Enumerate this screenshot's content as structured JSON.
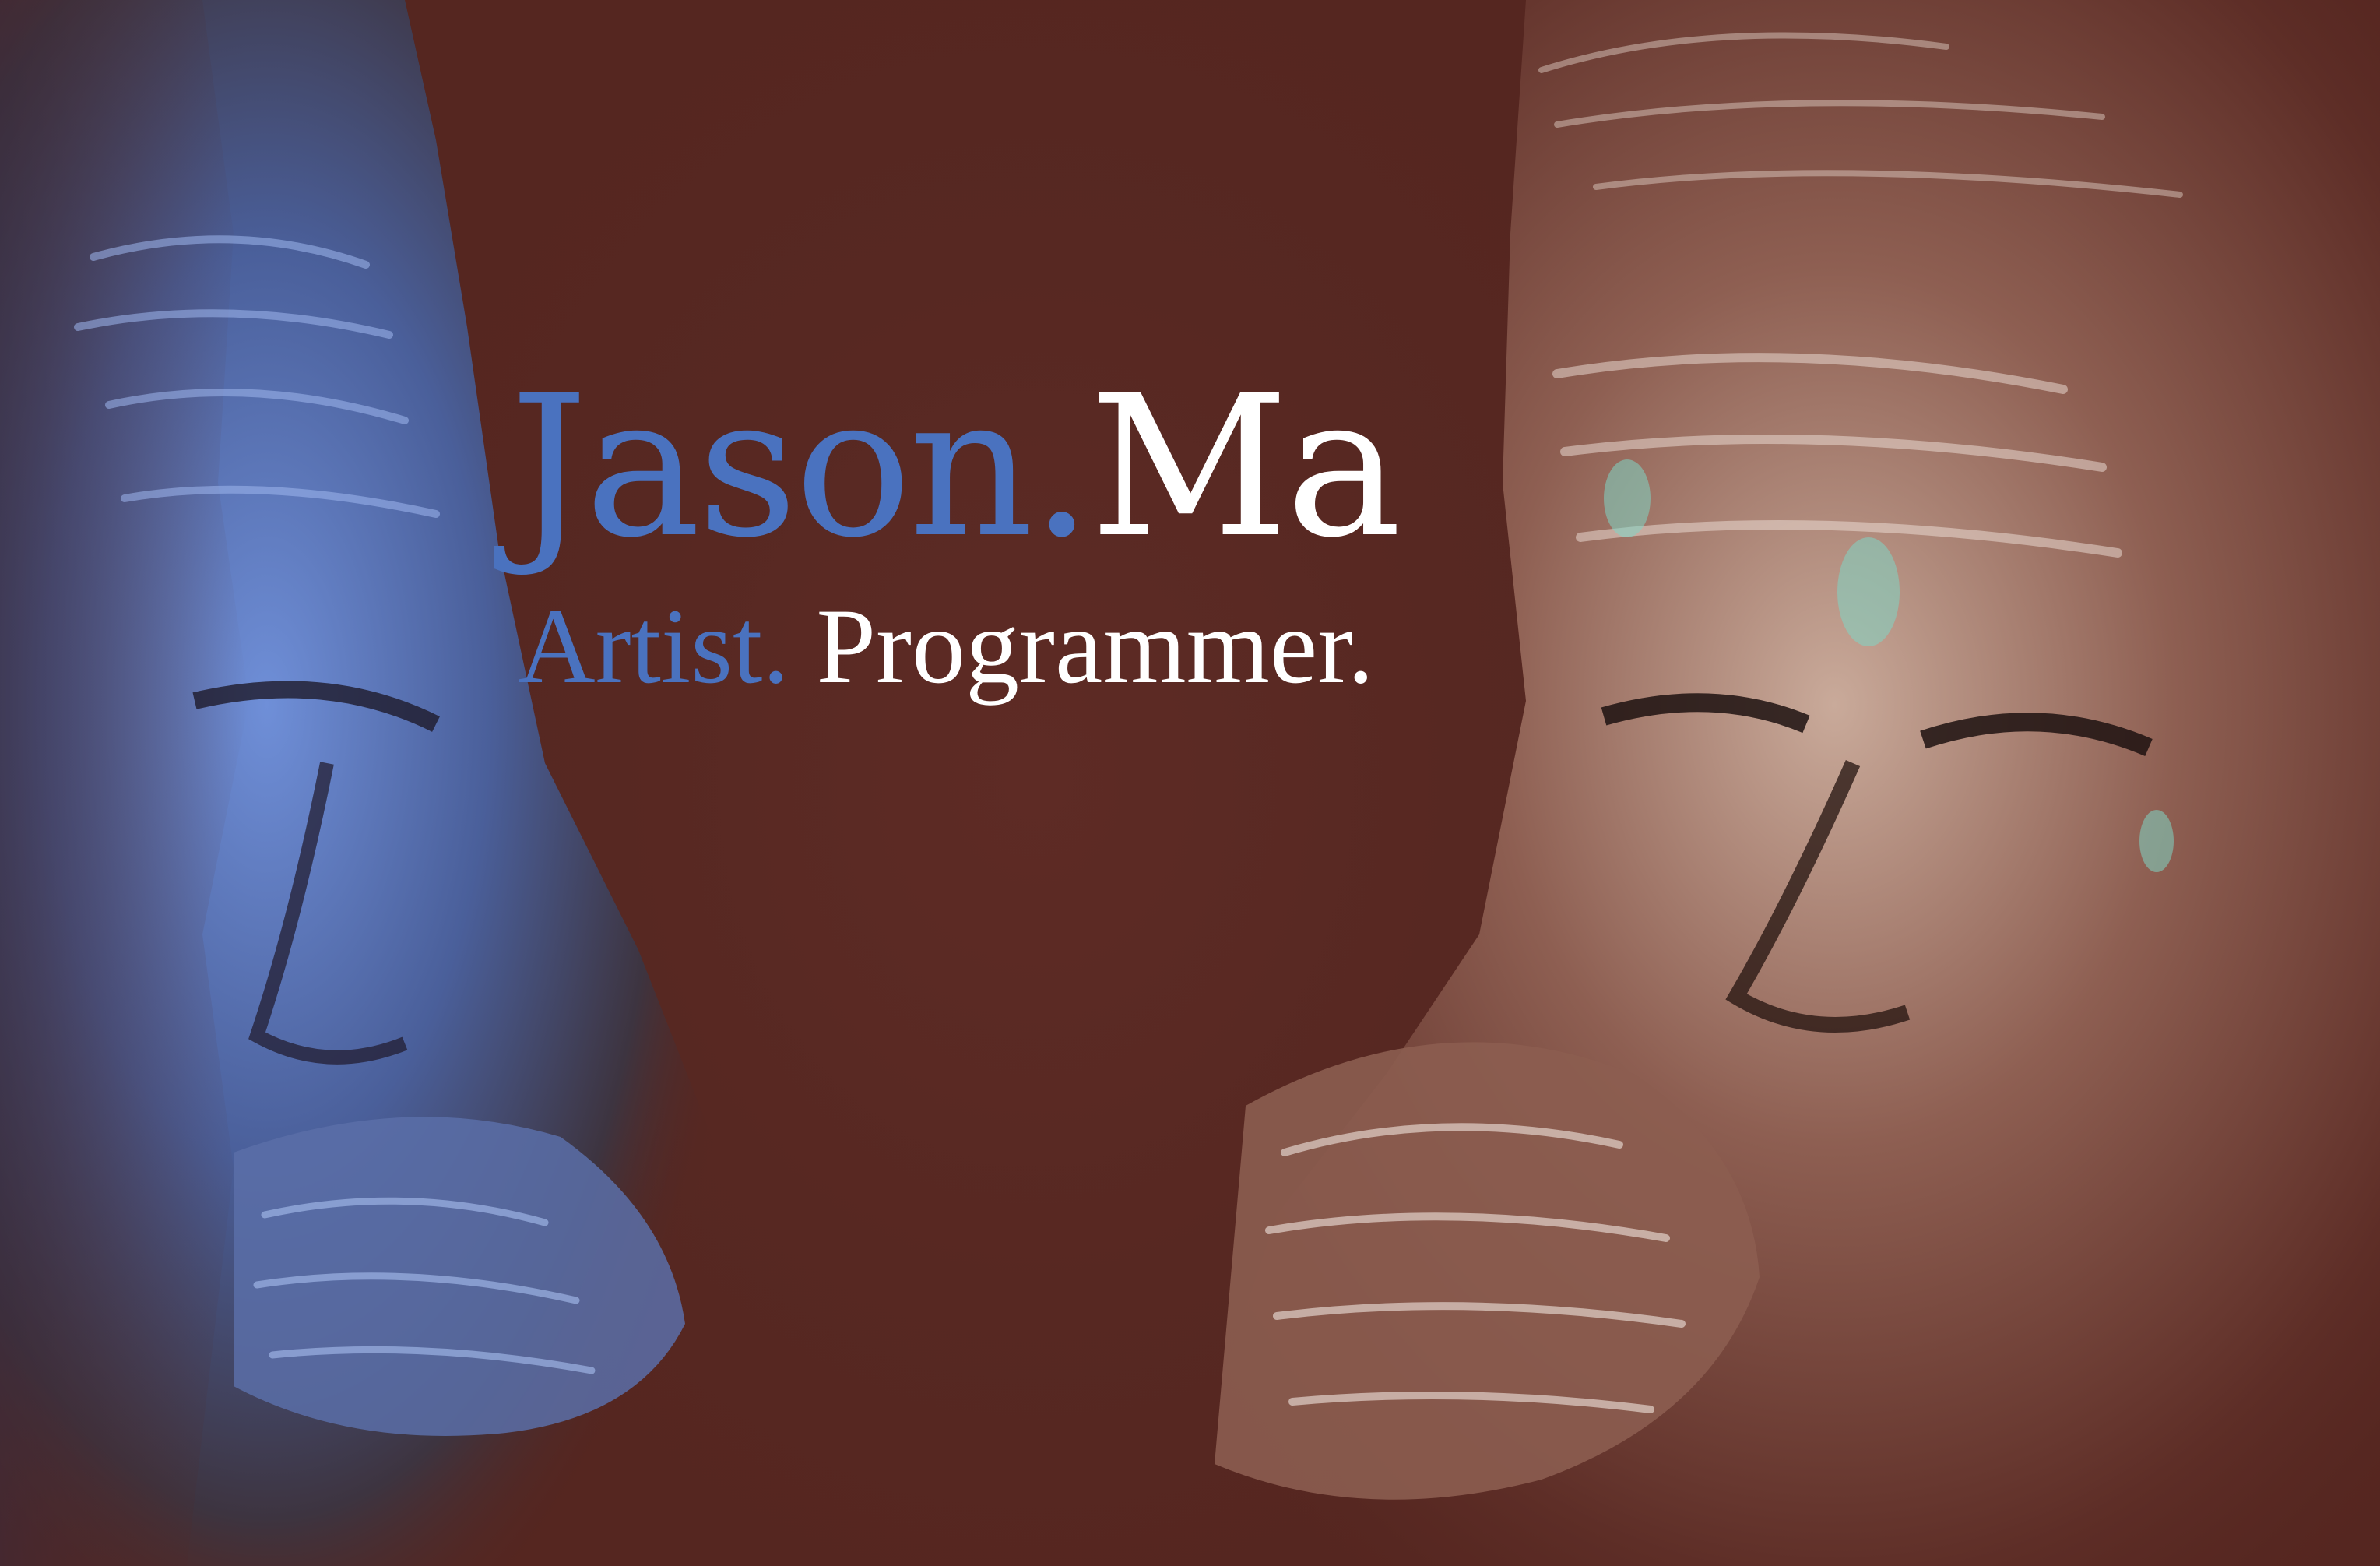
{
  "colors": {
    "background": "#552620",
    "accent_blue": "#4a72bf",
    "text_white": "#ffffff"
  },
  "title": {
    "first": "Jason.",
    "last": "Ma"
  },
  "tagline": {
    "role1": "Artist.",
    "role2": "Programmer."
  },
  "artwork": [
    "pastel-portrait-blue",
    "pastel-portrait-sepia"
  ]
}
